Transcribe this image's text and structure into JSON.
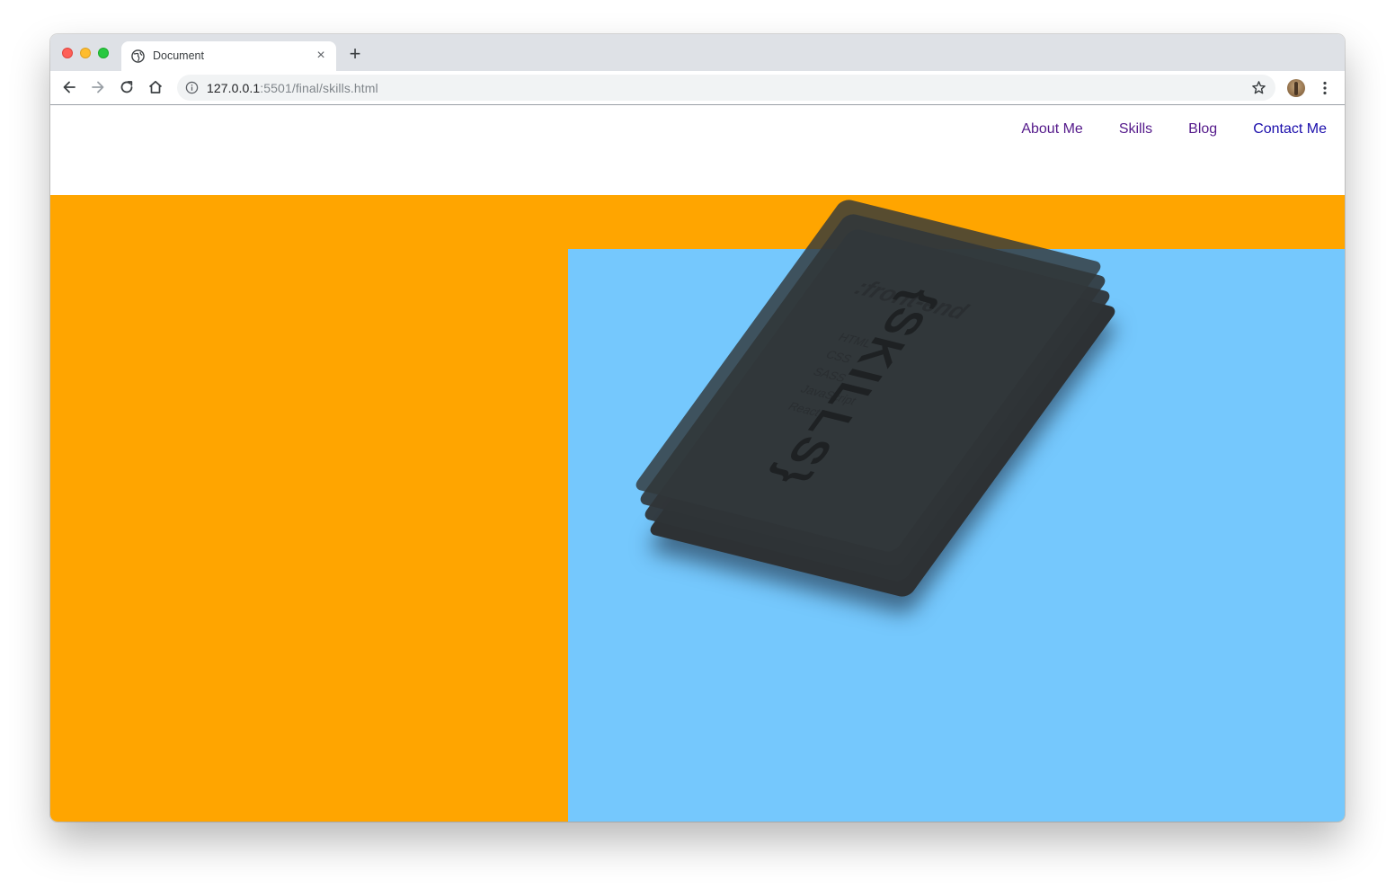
{
  "browser": {
    "tab_title": "Document",
    "tab_close": "×",
    "new_tab": "+",
    "url_host": "127.0.0.1",
    "url_rest": ":5501/final/skills.html"
  },
  "nav": {
    "items": [
      {
        "label": "About Me"
      },
      {
        "label": "Skills"
      },
      {
        "label": "Blog"
      },
      {
        "label": "Contact Me"
      }
    ]
  },
  "card": {
    "title": "{SKILLS}",
    "subtitle": ":front-end",
    "list": [
      "HTML",
      "CSS",
      "SASS",
      "JavaScript",
      "React"
    ]
  },
  "colors": {
    "orange": "#ffa500",
    "blue": "#75c8fd",
    "card": "#2f3336",
    "nav_visited": "#551a8b",
    "nav_link": "#1a0dab"
  },
  "icons": [
    "globe-icon",
    "back-icon",
    "forward-icon",
    "reload-icon",
    "home-icon",
    "info-icon",
    "star-icon",
    "menu-icon"
  ]
}
